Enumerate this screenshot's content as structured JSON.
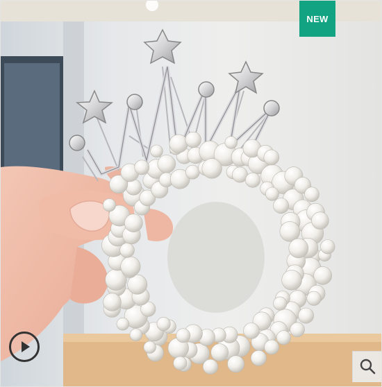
{
  "badge": {
    "label": "NEW",
    "color": "#12a383"
  },
  "icons": {
    "play": "play-icon",
    "zoom": "search-icon"
  }
}
